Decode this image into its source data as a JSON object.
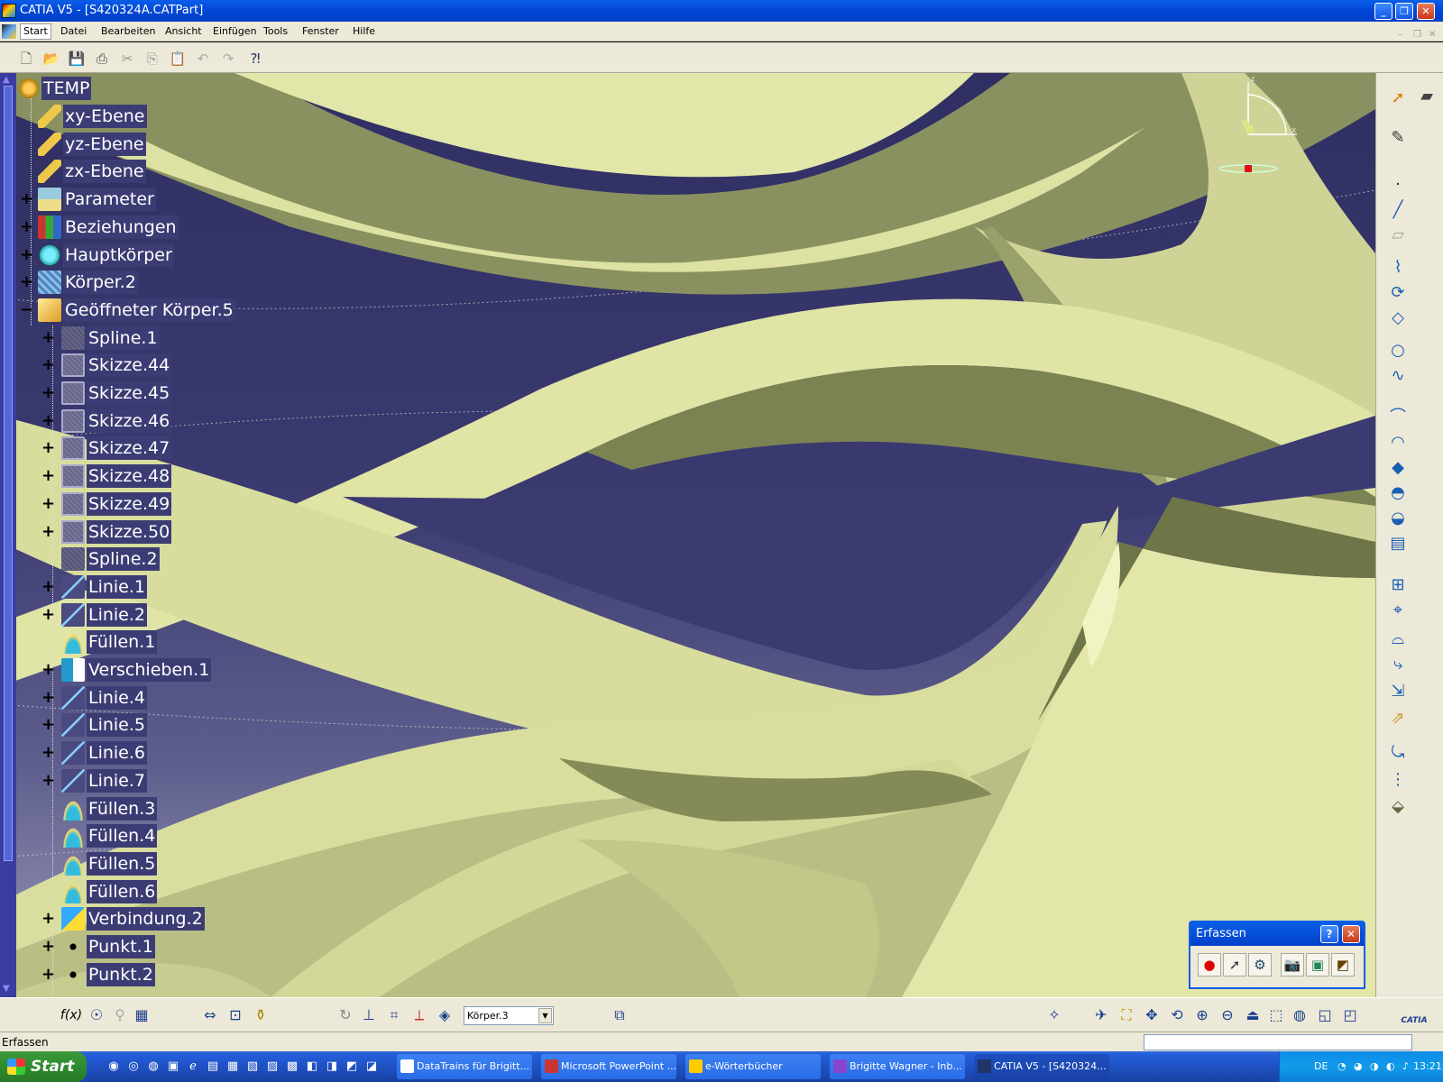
{
  "window": {
    "title": "CATIA V5 - [S420324A.CATPart]",
    "controls": {
      "minimize": "_",
      "restore": "❐",
      "close": "✕"
    }
  },
  "menubar": {
    "items": [
      "Start",
      "Datei",
      "Bearbeiten",
      "Ansicht",
      "Einfügen",
      "Tools",
      "Fenster",
      "Hilfe"
    ],
    "mdi_controls": [
      "–",
      "❐",
      "✕"
    ]
  },
  "toolbar": {
    "icons": [
      "new-icon",
      "open-icon",
      "save-icon",
      "print-icon",
      "cut-icon",
      "copy-icon",
      "paste-icon",
      "undo-icon",
      "redo-icon",
      "whats-this-icon"
    ]
  },
  "tree": {
    "root": "TEMP",
    "nodes": [
      {
        "label": "xy-Ebene",
        "level": 1,
        "expander": false,
        "icon": "plane-icon"
      },
      {
        "label": "yz-Ebene",
        "level": 1,
        "expander": false,
        "icon": "plane-icon"
      },
      {
        "label": "zx-Ebene",
        "level": 1,
        "expander": false,
        "icon": "plane-icon"
      },
      {
        "label": "Parameter",
        "level": 1,
        "expander": "+",
        "icon": "parameter-icon"
      },
      {
        "label": "Beziehungen",
        "level": 1,
        "expander": "+",
        "icon": "relations-icon"
      },
      {
        "label": "Hauptkörper",
        "level": 1,
        "expander": "+",
        "icon": "partbody-icon"
      },
      {
        "label": "Körper.2",
        "level": 1,
        "expander": "+",
        "icon": "body-icon"
      },
      {
        "label": "Geöffneter Körper.5",
        "level": 1,
        "expander": "–",
        "icon": "open-body-icon"
      },
      {
        "label": "Spline.1",
        "level": 2,
        "expander": "+",
        "icon": "spline-icon"
      },
      {
        "label": "Skizze.44",
        "level": 2,
        "expander": "+",
        "icon": "sketch-icon"
      },
      {
        "label": "Skizze.45",
        "level": 2,
        "expander": "+",
        "icon": "sketch-icon"
      },
      {
        "label": "Skizze.46",
        "level": 2,
        "expander": "+",
        "icon": "sketch-icon"
      },
      {
        "label": "Skizze.47",
        "level": 2,
        "expander": "+",
        "icon": "sketch-icon"
      },
      {
        "label": "Skizze.48",
        "level": 2,
        "expander": "+",
        "icon": "sketch-icon"
      },
      {
        "label": "Skizze.49",
        "level": 2,
        "expander": "+",
        "icon": "sketch-icon"
      },
      {
        "label": "Skizze.50",
        "level": 2,
        "expander": "+",
        "icon": "sketch-icon"
      },
      {
        "label": "Spline.2",
        "level": 2,
        "expander": false,
        "icon": "spline-icon"
      },
      {
        "label": "Linie.1",
        "level": 2,
        "expander": "+",
        "icon": "line-icon"
      },
      {
        "label": "Linie.2",
        "level": 2,
        "expander": "+",
        "icon": "line-icon"
      },
      {
        "label": "Füllen.1",
        "level": 2,
        "expander": false,
        "icon": "fill-icon"
      },
      {
        "label": "Verschieben.1",
        "level": 2,
        "expander": "+",
        "icon": "translate-icon"
      },
      {
        "label": "Linie.4",
        "level": 2,
        "expander": "+",
        "icon": "line-icon"
      },
      {
        "label": "Linie.5",
        "level": 2,
        "expander": "+",
        "icon": "line-icon"
      },
      {
        "label": "Linie.6",
        "level": 2,
        "expander": "+",
        "icon": "line-icon"
      },
      {
        "label": "Linie.7",
        "level": 2,
        "expander": "+",
        "icon": "line-icon"
      },
      {
        "label": "Füllen.3",
        "level": 2,
        "expander": false,
        "icon": "fill-icon"
      },
      {
        "label": "Füllen.4",
        "level": 2,
        "expander": false,
        "icon": "fill-icon"
      },
      {
        "label": "Füllen.5",
        "level": 2,
        "expander": false,
        "icon": "fill-icon"
      },
      {
        "label": "Füllen.6",
        "level": 2,
        "expander": false,
        "icon": "fill-icon"
      },
      {
        "label": "Verbindung.2",
        "level": 2,
        "expander": "+",
        "icon": "join-icon"
      },
      {
        "label": "Punkt.1",
        "level": 2,
        "expander": "+",
        "icon": "point-icon"
      },
      {
        "label": "Punkt.2",
        "level": 2,
        "expander": "+",
        "icon": "point-icon"
      }
    ]
  },
  "compass": {
    "axis_z": "z",
    "axis_x": "x"
  },
  "right_toolbar": {
    "icons": [
      "select-icon",
      "sketcher-icon",
      "point-icon",
      "line-icon",
      "plane-icon",
      "extrude-surface-icon",
      "revolve-surface-icon",
      "offset-icon",
      "circle-icon",
      "spline-icon",
      "sweep-icon",
      "loft-icon",
      "blend-icon",
      "fill-icon",
      "multi-section-icon",
      "join-icon",
      "split-icon",
      "trim-icon",
      "boundary-icon",
      "extract-icon",
      "extrapolate-icon",
      "translate-icon",
      "repetition-icon",
      "grid-icon",
      "shape-icon"
    ]
  },
  "erfassen_dialog": {
    "title": "Erfassen",
    "help": "?",
    "close": "✕",
    "icons": [
      "record-icon",
      "select-icon",
      "options-icon",
      "camera-icon",
      "capture-image-icon",
      "album-icon"
    ]
  },
  "bottom_toolbar": {
    "formula_label": "f(x)",
    "body_select": "Körper.3",
    "catia_logo": "CATIA"
  },
  "status": {
    "text": "Erfassen"
  },
  "taskbar": {
    "start": "Start",
    "tasks": [
      {
        "label": "DataTrains für Brigitt...",
        "active": false
      },
      {
        "label": "Microsoft PowerPoint ...",
        "active": false
      },
      {
        "label": "e-Wörterbücher",
        "active": false
      },
      {
        "label": "Brigitte Wagner - Inb...",
        "active": false
      },
      {
        "label": "CATIA V5 - [S420324...",
        "active": true
      }
    ],
    "language": "DE",
    "clock": "13:21"
  },
  "colors": {
    "viewport_top": "#2f2f63",
    "surface": "#e2e6a8",
    "surface_shade": "#7f8654",
    "tree_label_bg": "#3c3c74",
    "xp_blue": "#0a5ee8"
  }
}
